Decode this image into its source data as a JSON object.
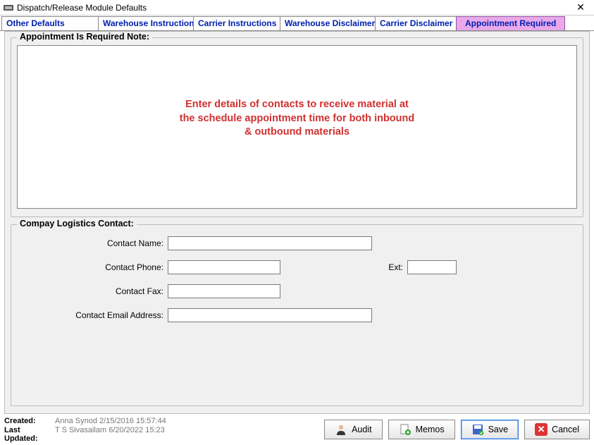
{
  "window": {
    "title": "Dispatch/Release Module Defaults"
  },
  "tabs": {
    "other_defaults": "Other Defaults",
    "warehouse_instructions": "Warehouse Instructions",
    "carrier_instructions": "Carrier Instructions",
    "warehouse_disclaimer": "Warehouse Disclaimer",
    "carrier_disclaimer": "Carrier Disclaimer",
    "appointment_required": "Appointment Required"
  },
  "group1": {
    "legend": "Appointment Is Required Note:",
    "note_value": "",
    "overlay": "Enter details of contacts to receive material at the schedule appointment time for both inbound & outbound materials"
  },
  "group2": {
    "legend": "Compay Logistics Contact:",
    "fields": {
      "name_label": "Contact Name:",
      "name_value": "",
      "phone_label": "Contact Phone:",
      "phone_value": "",
      "ext_label": "Ext:",
      "ext_value": "",
      "fax_label": "Contact Fax:",
      "fax_value": "",
      "email_label": "Contact Email Address:",
      "email_value": ""
    }
  },
  "status": {
    "created_label": "Created:",
    "created_value": "Anna Synod 2/15/2016 15:57:44",
    "updated_label": "Last Updated:",
    "updated_value": "T S Sivasailam 6/20/2022 15:23"
  },
  "buttons": {
    "audit": "Audit",
    "memos": "Memos",
    "save": "Save",
    "cancel": "Cancel"
  }
}
